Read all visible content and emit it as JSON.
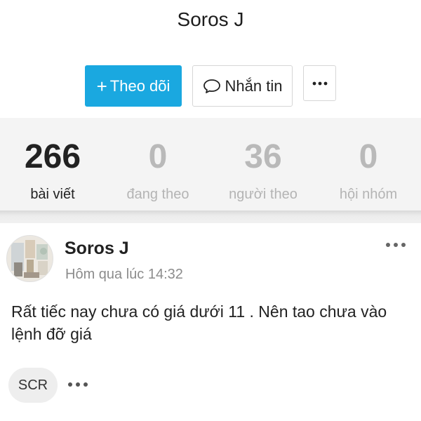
{
  "profile": {
    "name": "Soros J"
  },
  "actions": {
    "follow_icon": "+",
    "follow_label": "Theo dõi",
    "message_label": "Nhắn tin",
    "message_icon": "speech-bubble-icon",
    "more_icon": "more-horizontal-icon"
  },
  "stats": [
    {
      "value": "266",
      "label": "bài viết",
      "active": true
    },
    {
      "value": "0",
      "label": "đang theo",
      "active": false
    },
    {
      "value": "36",
      "label": "người theo",
      "active": false
    },
    {
      "value": "0",
      "label": "hội nhóm",
      "active": false
    }
  ],
  "post": {
    "author": "Soros J",
    "time": "Hôm qua lúc 14:32",
    "body": "Rất tiếc nay chưa có giá dưới 11 . Nên tao chưa vào lệnh đỡ giá",
    "tag": "SCR"
  },
  "colors": {
    "accent": "#1aa8e0",
    "stats_background": "#f4f4f4",
    "muted_text": "#b4b4b4"
  }
}
